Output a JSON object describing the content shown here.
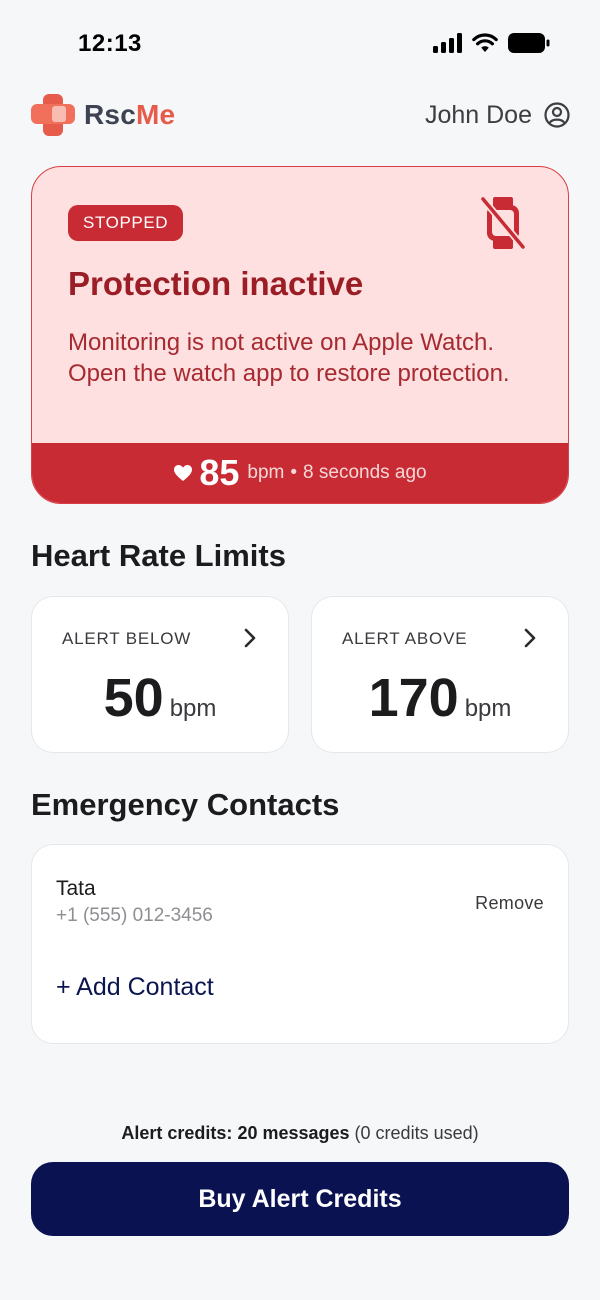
{
  "status_bar": {
    "time": "12:13"
  },
  "header": {
    "brand_part1": "Rsc",
    "brand_part2": "Me",
    "user_name": "John Doe"
  },
  "protection": {
    "badge": "STOPPED",
    "title": "Protection inactive",
    "description": "Monitoring is not active on Apple Watch. Open the watch app to restore protection.",
    "heart_rate": "85",
    "unit": "bpm",
    "separator": "•",
    "last_updated": "8 seconds ago"
  },
  "limits": {
    "section_title": "Heart Rate Limits",
    "below": {
      "label": "ALERT BELOW",
      "value": "50",
      "unit": "bpm"
    },
    "above": {
      "label": "ALERT ABOVE",
      "value": "170",
      "unit": "bpm"
    }
  },
  "contacts": {
    "section_title": "Emergency Contacts",
    "items": [
      {
        "name": "Tata",
        "phone": "+1 (555) 012-3456",
        "remove_label": "Remove"
      }
    ],
    "add_label": "+ Add Contact"
  },
  "credits": {
    "label": "Alert credits:",
    "count": "20 messages",
    "used": "(0 credits used)",
    "buy_label": "Buy Alert Credits"
  },
  "colors": {
    "brand_primary": "#e65b4a",
    "alert_red": "#c92b35",
    "alert_bg": "#fde0df",
    "navy": "#0b1252"
  },
  "icons": {
    "logo": "heart-cross-icon",
    "user": "user-circle-icon",
    "watch_off": "watch-off-icon",
    "heart": "heart-icon",
    "chevron": "chevron-right-icon"
  }
}
